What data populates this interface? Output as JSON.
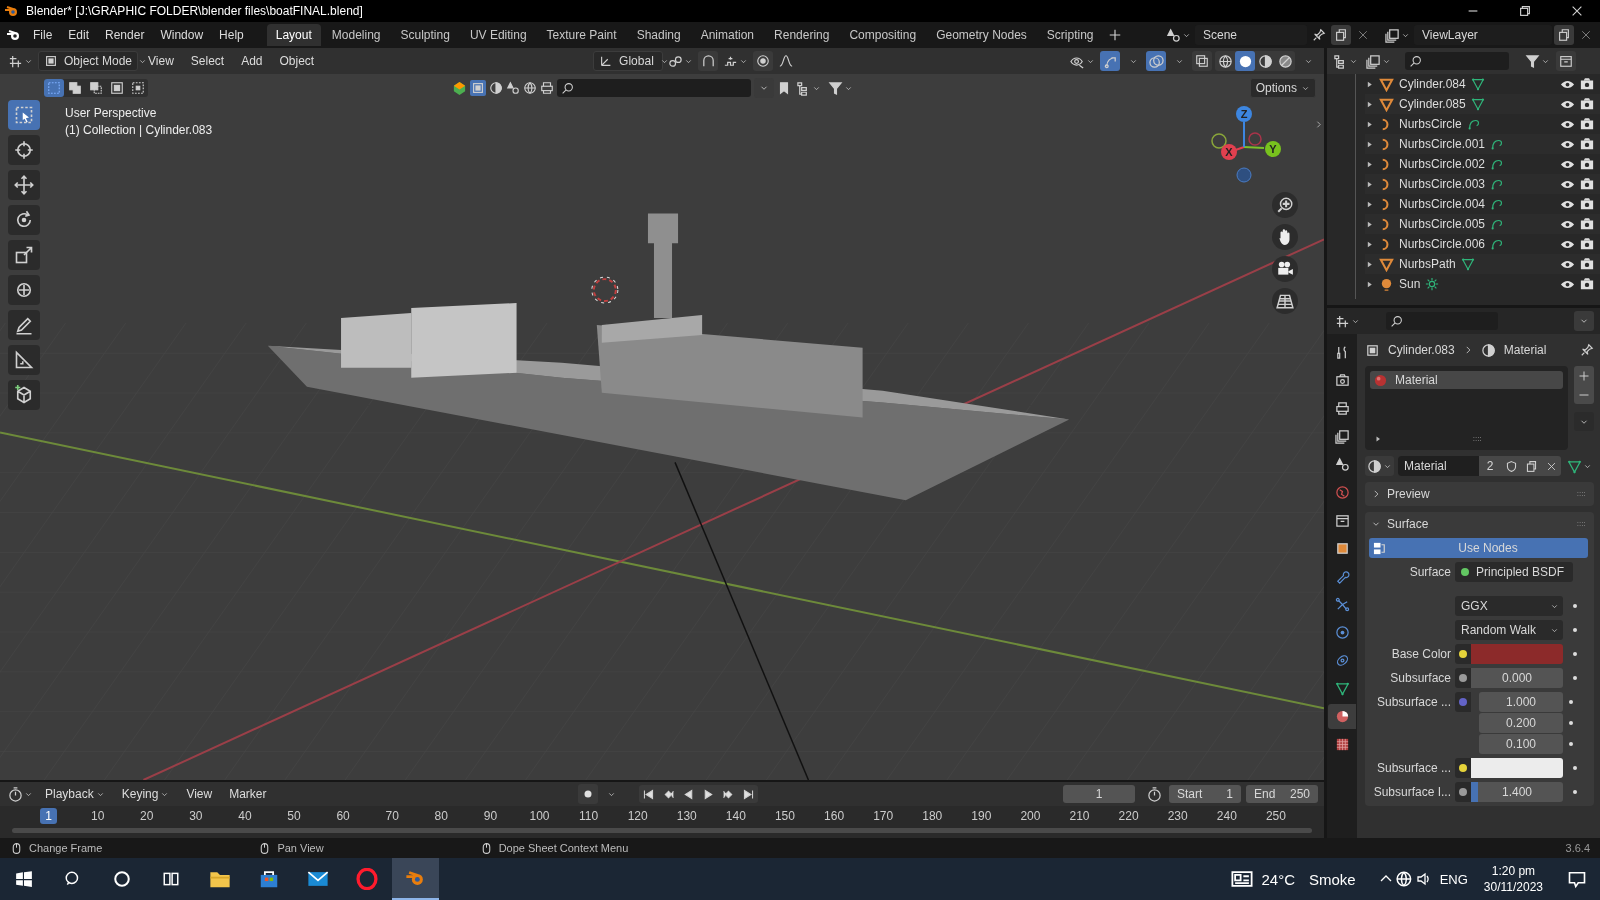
{
  "window": {
    "title": "Blender* [J:\\GRAPHIC FOLDER\\blender files\\boatFINAL.blend]"
  },
  "menu": [
    "File",
    "Edit",
    "Render",
    "Window",
    "Help"
  ],
  "workspaces": [
    {
      "label": "Layout",
      "selected": true
    },
    {
      "label": "Modeling",
      "selected": false
    },
    {
      "label": "Sculpting",
      "selected": false
    },
    {
      "label": "UV Editing",
      "selected": false
    },
    {
      "label": "Texture Paint",
      "selected": false
    },
    {
      "label": "Shading",
      "selected": false
    },
    {
      "label": "Animation",
      "selected": false
    },
    {
      "label": "Rendering",
      "selected": false
    },
    {
      "label": "Compositing",
      "selected": false
    },
    {
      "label": "Geometry Nodes",
      "selected": false
    },
    {
      "label": "Scripting",
      "selected": false
    }
  ],
  "scene": {
    "name": "Scene"
  },
  "view_layer": {
    "name": "ViewLayer"
  },
  "viewport": {
    "mode": "Object Mode",
    "menus": [
      "View",
      "Select",
      "Add",
      "Object"
    ],
    "orientation": "Global",
    "options": "Options",
    "view_name": "User Perspective",
    "collection_info": "(1) Collection | Cylinder.083",
    "gizmos_on": true,
    "overlays_on": true,
    "tools": [
      {
        "kind": "select",
        "selected": true
      },
      {
        "kind": "cursor",
        "selected": false
      },
      {
        "kind": "move",
        "selected": false
      },
      {
        "kind": "rotate",
        "selected": false
      },
      {
        "kind": "scale",
        "selected": false
      },
      {
        "kind": "transform",
        "selected": false
      },
      {
        "kind": "annotate",
        "selected": false
      },
      {
        "kind": "measure",
        "selected": false
      },
      {
        "kind": "add-cube",
        "selected": false
      }
    ],
    "shading": [
      {
        "kind": "wireframe",
        "selected": false
      },
      {
        "kind": "solid",
        "selected": true
      },
      {
        "kind": "material",
        "selected": false
      },
      {
        "kind": "rendered",
        "selected": false
      }
    ],
    "gizmo_labels": [
      "X",
      "Y",
      "Z"
    ]
  },
  "outliner": {
    "items": [
      {
        "name": "Cylinder.084",
        "kind": "mesh"
      },
      {
        "name": "Cylinder.085",
        "kind": "mesh"
      },
      {
        "name": "NurbsCircle",
        "kind": "curve"
      },
      {
        "name": "NurbsCircle.001",
        "kind": "curve"
      },
      {
        "name": "NurbsCircle.002",
        "kind": "curve"
      },
      {
        "name": "NurbsCircle.003",
        "kind": "curve"
      },
      {
        "name": "NurbsCircle.004",
        "kind": "curve"
      },
      {
        "name": "NurbsCircle.005",
        "kind": "curve"
      },
      {
        "name": "NurbsCircle.006",
        "kind": "curve"
      },
      {
        "name": "NurbsPath",
        "kind": "mesh"
      },
      {
        "name": "Sun",
        "kind": "light"
      }
    ]
  },
  "properties": {
    "tabs": [
      {
        "kind": "tool",
        "selected": false
      },
      {
        "kind": "render",
        "selected": false
      },
      {
        "kind": "output",
        "selected": false
      },
      {
        "kind": "view-layer",
        "selected": false
      },
      {
        "kind": "scene",
        "selected": false
      },
      {
        "kind": "world",
        "selected": false
      },
      {
        "kind": "collection",
        "selected": false
      },
      {
        "kind": "object",
        "selected": false
      },
      {
        "kind": "modifiers",
        "selected": false
      },
      {
        "kind": "particles",
        "selected": false
      },
      {
        "kind": "physics",
        "selected": false
      },
      {
        "kind": "constraints",
        "selected": false
      },
      {
        "kind": "data",
        "selected": false
      },
      {
        "kind": "material",
        "selected": true
      },
      {
        "kind": "texture",
        "selected": false
      }
    ],
    "breadcrumb": [
      "Cylinder.083",
      "Material"
    ],
    "slots": [
      {
        "name": "Material",
        "selected": true
      }
    ],
    "material": {
      "name": "Material",
      "users": "2"
    },
    "panels": [
      {
        "title": "Preview",
        "expanded": false
      },
      {
        "title": "Surface",
        "expanded": true
      }
    ],
    "use_nodes": "Use Nodes",
    "surface": {
      "label": "Surface",
      "value": "Principled BSDF"
    },
    "dropdowns": [
      "GGX",
      "Random Walk"
    ],
    "inputs": [
      {
        "label": "Base Color",
        "kind": "color",
        "color": "#8c2a2a"
      },
      {
        "label": "Subsurface",
        "kind": "number",
        "values": [
          "0.000"
        ]
      },
      {
        "label": "Subsurface ...",
        "kind": "vector",
        "values": [
          "1.000",
          "0.200",
          "0.100"
        ]
      },
      {
        "label": "Subsurface ...",
        "kind": "color",
        "color": "#ececec"
      },
      {
        "label": "Subsurface I...",
        "kind": "slider",
        "values": [
          "1.400"
        ],
        "level": 0.08
      }
    ]
  },
  "timeline": {
    "menus": [
      "Playback",
      "Keying",
      "View",
      "Marker"
    ],
    "current_frame": "1",
    "start_label": "Start",
    "start": "1",
    "end_label": "End",
    "end": "250",
    "ruler": [
      {
        "label": "1",
        "selected": true
      },
      {
        "label": "10",
        "selected": false
      },
      {
        "label": "20",
        "selected": false
      },
      {
        "label": "30",
        "selected": false
      },
      {
        "label": "40",
        "selected": false
      },
      {
        "label": "50",
        "selected": false
      },
      {
        "label": "60",
        "selected": false
      },
      {
        "label": "70",
        "selected": false
      },
      {
        "label": "80",
        "selected": false
      },
      {
        "label": "90",
        "selected": false
      },
      {
        "label": "100",
        "selected": false
      },
      {
        "label": "110",
        "selected": false
      },
      {
        "label": "120",
        "selected": false
      },
      {
        "label": "130",
        "selected": false
      },
      {
        "label": "140",
        "selected": false
      },
      {
        "label": "150",
        "selected": false
      },
      {
        "label": "160",
        "selected": false
      },
      {
        "label": "170",
        "selected": false
      },
      {
        "label": "180",
        "selected": false
      },
      {
        "label": "190",
        "selected": false
      },
      {
        "label": "200",
        "selected": false
      },
      {
        "label": "210",
        "selected": false
      },
      {
        "label": "220",
        "selected": false
      },
      {
        "label": "230",
        "selected": false
      },
      {
        "label": "240",
        "selected": false
      },
      {
        "label": "250",
        "selected": false
      }
    ]
  },
  "status_bar": {
    "hints": [
      "Change Frame",
      "Pan View",
      "Dope Sheet Context Menu"
    ],
    "version": "3.6.4"
  },
  "taskbar": {
    "temperature": "24°C",
    "weather": "Smoke",
    "language": "ENG",
    "time": "1:20 pm",
    "date": "30/11/2023"
  }
}
